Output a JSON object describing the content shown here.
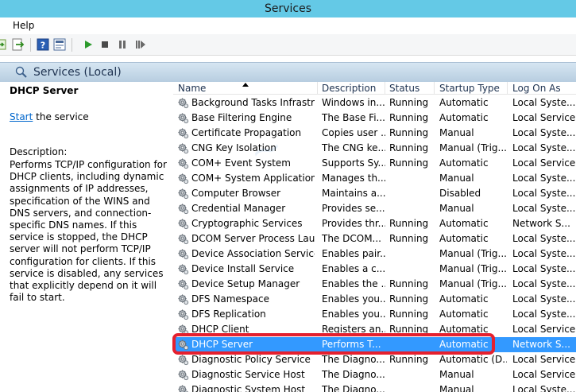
{
  "window": {
    "title": "Services"
  },
  "menu": {
    "help_label": "Help"
  },
  "scope": {
    "title": "Services (Local)"
  },
  "details": {
    "service_name": "DHCP Server",
    "start_link": "Start",
    "start_suffix": " the service",
    "description_label": "Description:",
    "description": "Performs TCP/IP configuration for DHCP clients, including dynamic assignments of IP addresses, specification of the WINS and DNS servers, and connection-specific DNS names. If this service is stopped, the DHCP server will not perform TCP/IP configuration for clients. If this service is disabled, any services that explicitly depend on it will fail to start."
  },
  "columns": {
    "name": "Name",
    "description": "Description",
    "status": "Status",
    "startup_type": "Startup Type",
    "log_on_as": "Log On As"
  },
  "rows": [
    {
      "name": "Background Tasks Infrastru...",
      "description": "Windows in...",
      "status": "Running",
      "startup": "Automatic",
      "logon": "Local Syste..."
    },
    {
      "name": "Base Filtering Engine",
      "description": "The Base Fi...",
      "status": "Running",
      "startup": "Automatic",
      "logon": "Local Service"
    },
    {
      "name": "Certificate Propagation",
      "description": "Copies user ...",
      "status": "Running",
      "startup": "Manual",
      "logon": "Local Syste..."
    },
    {
      "name": "CNG Key Isolation",
      "description": "The CNG ke...",
      "status": "Running",
      "startup": "Manual (Trig...",
      "logon": "Local Syste..."
    },
    {
      "name": "COM+ Event System",
      "description": "Supports Sy...",
      "status": "Running",
      "startup": "Automatic",
      "logon": "Local Service"
    },
    {
      "name": "COM+ System Application",
      "description": "Manages th...",
      "status": "",
      "startup": "Manual",
      "logon": "Local Syste..."
    },
    {
      "name": "Computer Browser",
      "description": "Maintains a...",
      "status": "",
      "startup": "Disabled",
      "logon": "Local Syste..."
    },
    {
      "name": "Credential Manager",
      "description": "Provides se...",
      "status": "",
      "startup": "Manual",
      "logon": "Local Syste..."
    },
    {
      "name": "Cryptographic Services",
      "description": "Provides thr...",
      "status": "Running",
      "startup": "Automatic",
      "logon": "Network S..."
    },
    {
      "name": "DCOM Server Process Laun...",
      "description": "The DCOM...",
      "status": "Running",
      "startup": "Automatic",
      "logon": "Local Syste..."
    },
    {
      "name": "Device Association Service",
      "description": "Enables pair...",
      "status": "",
      "startup": "Manual (Trig...",
      "logon": "Local Syste..."
    },
    {
      "name": "Device Install Service",
      "description": "Enables a c...",
      "status": "",
      "startup": "Manual (Trig...",
      "logon": "Local Syste..."
    },
    {
      "name": "Device Setup Manager",
      "description": "Enables the ...",
      "status": "Running",
      "startup": "Manual (Trig...",
      "logon": "Local Syste..."
    },
    {
      "name": "DFS Namespace",
      "description": "Enables you...",
      "status": "Running",
      "startup": "Automatic",
      "logon": "Local Syste..."
    },
    {
      "name": "DFS Replication",
      "description": "Enables you...",
      "status": "Running",
      "startup": "Automatic",
      "logon": "Local Syste..."
    },
    {
      "name": "DHCP Client",
      "description": "Registers an...",
      "status": "Running",
      "startup": "Automatic",
      "logon": "Local Service"
    },
    {
      "name": "DHCP Server",
      "description": "Performs T...",
      "status": "",
      "startup": "Automatic",
      "logon": "Network S...",
      "selected": true
    },
    {
      "name": "Diagnostic Policy Service",
      "description": "The Diagno...",
      "status": "Running",
      "startup": "Automatic (D...",
      "logon": "Local Service"
    },
    {
      "name": "Diagnostic Service Host",
      "description": "The Diagno...",
      "status": "",
      "startup": "Manual",
      "logon": "Local Service"
    },
    {
      "name": "Diagnostic System Host",
      "description": "The Diagno...",
      "status": "",
      "startup": "Manual",
      "logon": "Local Syste..."
    }
  ],
  "colors": {
    "title_bar": "#64c9e6",
    "selection": "#3399ff",
    "highlight_ring": "#e5202e",
    "link": "#0066cc"
  },
  "icons": {
    "service_row": "gear-icon",
    "scope": "magnifier-gear-icon"
  }
}
